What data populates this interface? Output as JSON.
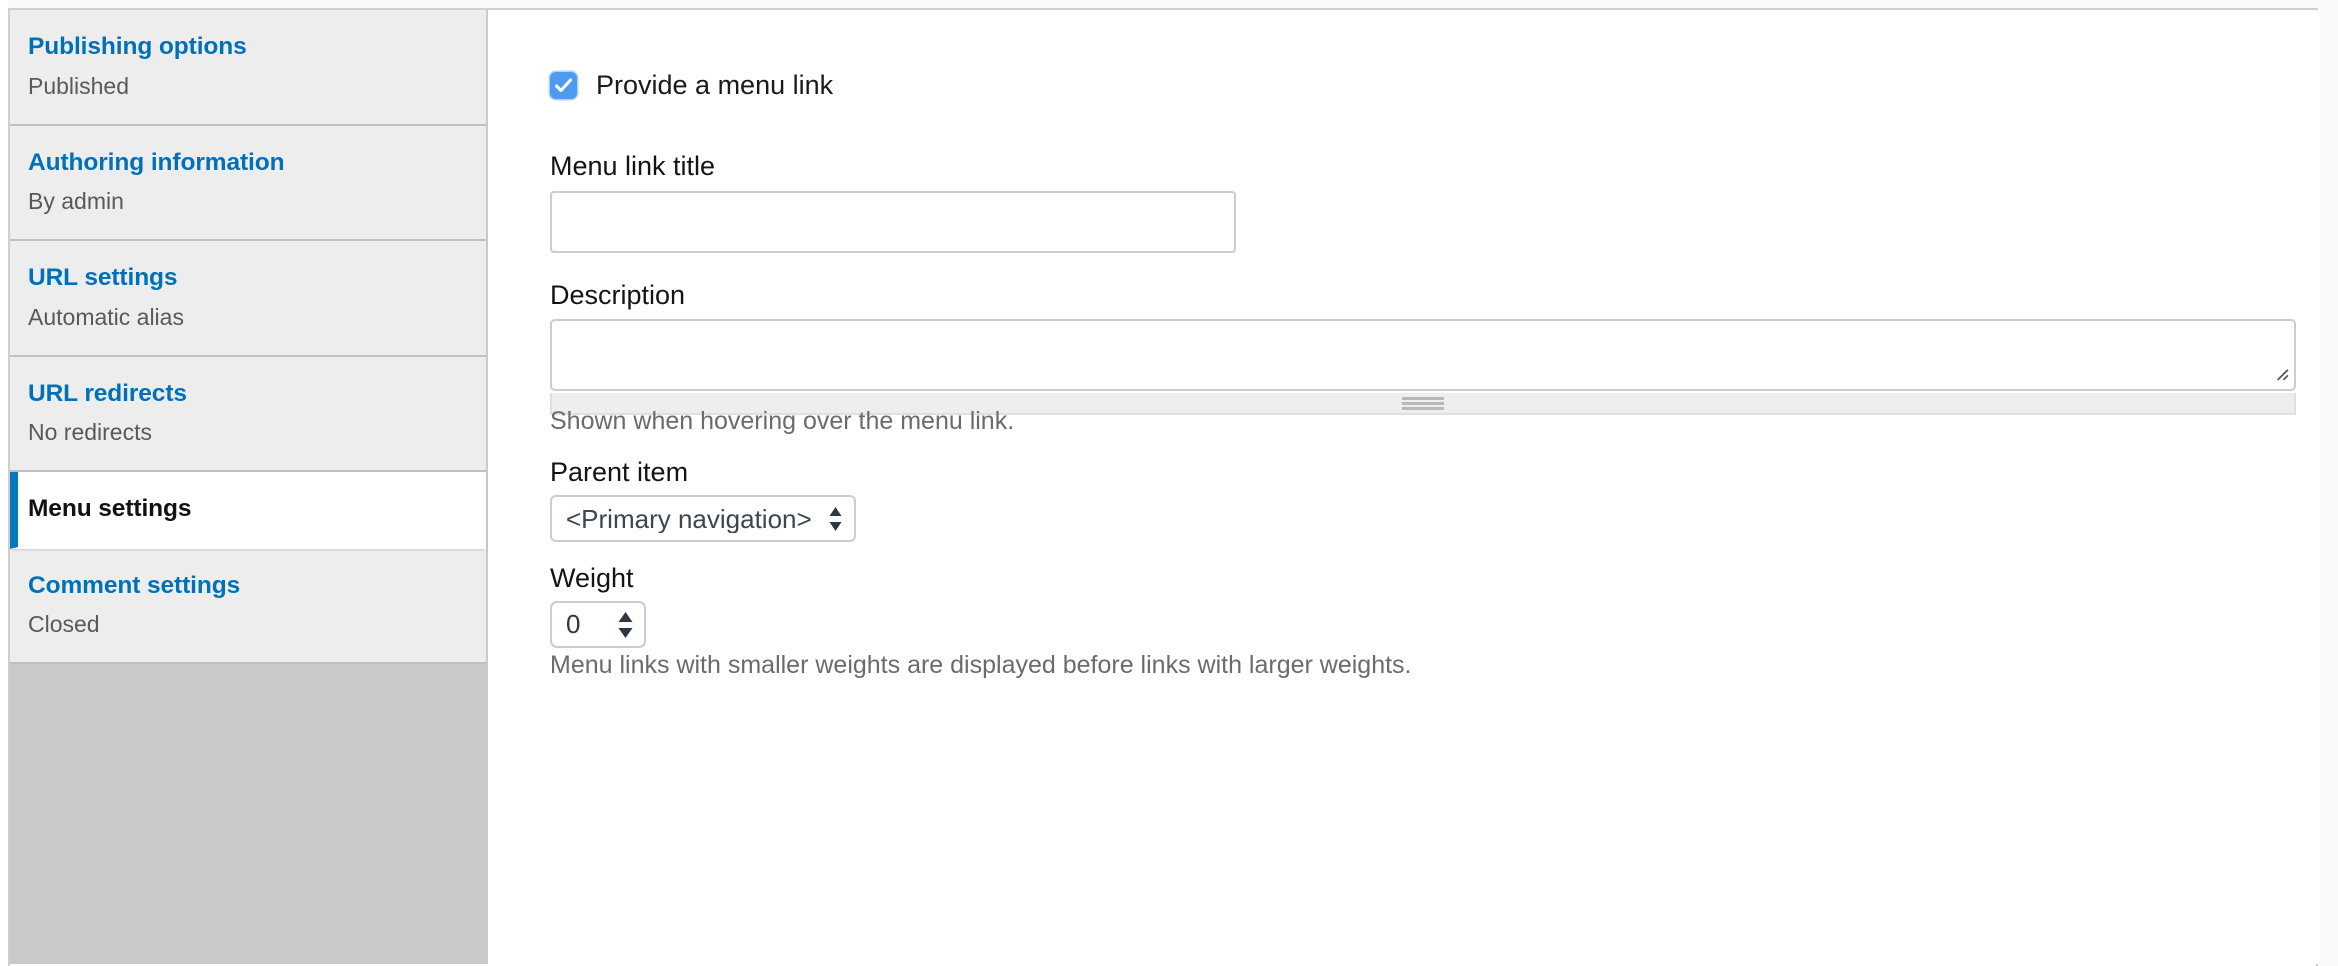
{
  "sidebar": {
    "items": [
      {
        "title": "Publishing options",
        "summary": "Published",
        "active": false
      },
      {
        "title": "Authoring information",
        "summary": "By admin",
        "active": false
      },
      {
        "title": "URL settings",
        "summary": "Automatic alias",
        "active": false
      },
      {
        "title": "URL redirects",
        "summary": "No redirects",
        "active": false
      },
      {
        "title": "Menu settings",
        "summary": "",
        "active": true
      },
      {
        "title": "Comment settings",
        "summary": "Closed",
        "active": false
      }
    ]
  },
  "form": {
    "provide_menu_link": {
      "label": "Provide a menu link",
      "checked": true
    },
    "menu_link_title": {
      "label": "Menu link title",
      "value": "",
      "placeholder": ""
    },
    "description": {
      "label": "Description",
      "value": "",
      "placeholder": "",
      "help": "Shown when hovering over the menu link."
    },
    "parent_item": {
      "label": "Parent item",
      "value": "<Primary navigation>",
      "options": [
        "<Primary navigation>"
      ]
    },
    "weight": {
      "label": "Weight",
      "value": "0",
      "help": "Menu links with smaller weights are displayed before links with larger weights."
    }
  },
  "colors": {
    "link_blue": "#0071b8",
    "active_tab_bar": "#0678be",
    "checkbox_blue": "#4d9bf0",
    "panel_bg": "#ededed",
    "page_bg": "#ffffff"
  }
}
